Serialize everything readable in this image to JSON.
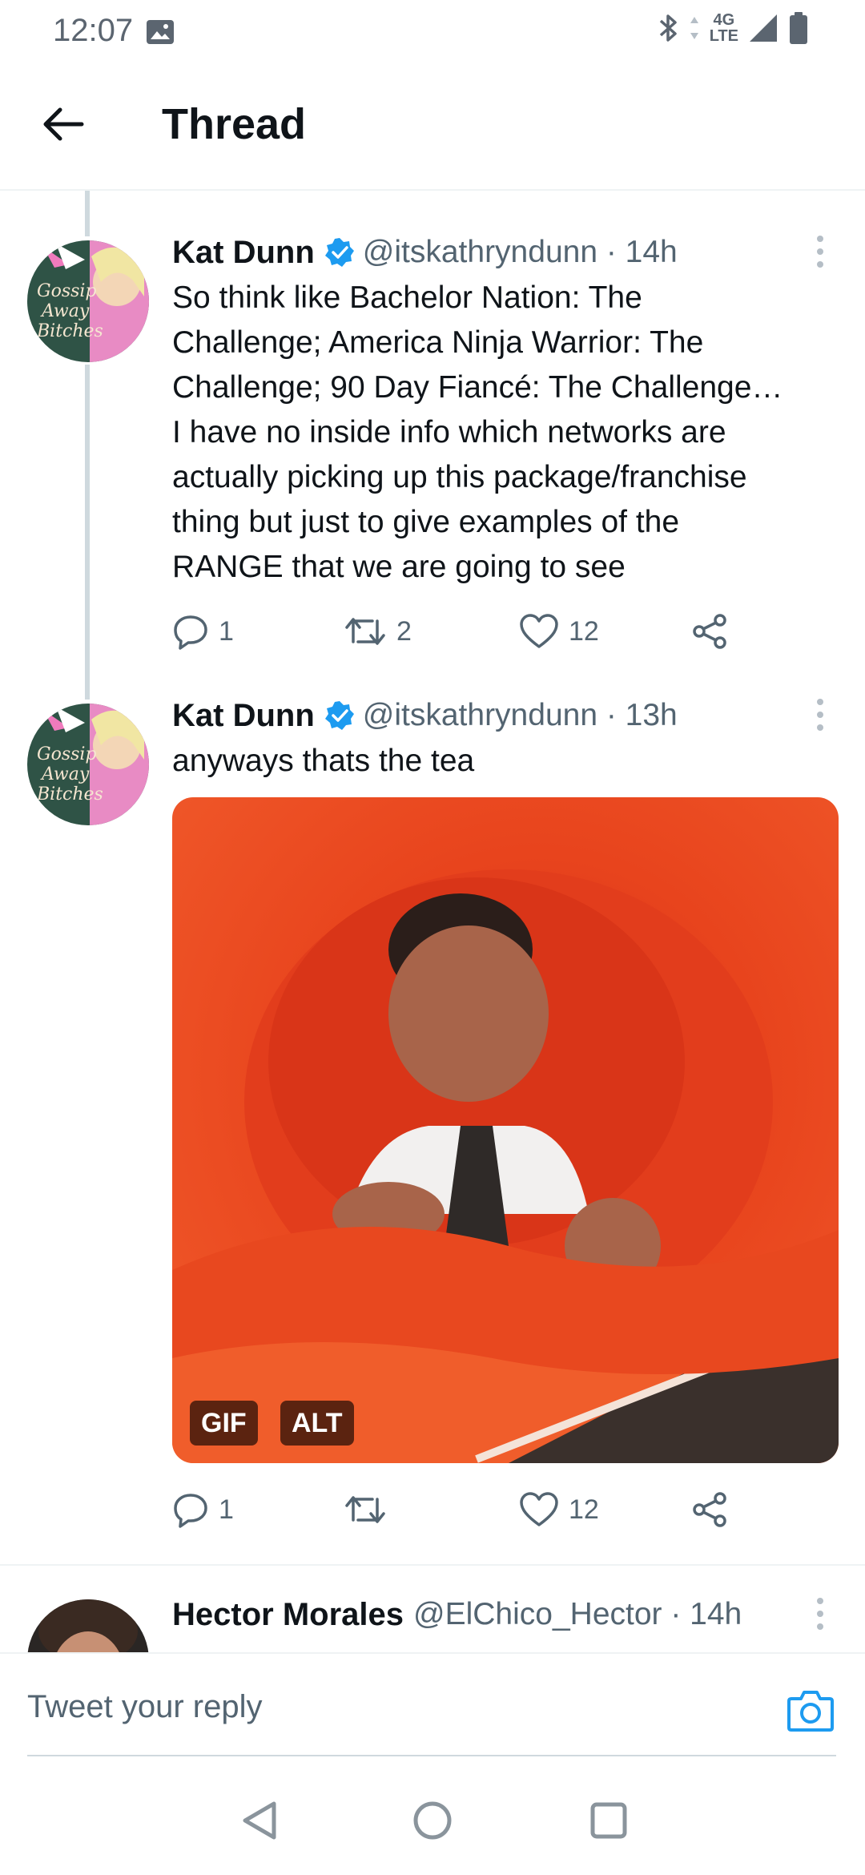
{
  "status_bar": {
    "time": "12:07",
    "network_label_top": "4G",
    "network_label_bottom": "LTE",
    "icons": [
      "photo-icon",
      "bluetooth-icon",
      "signal-icon",
      "battery-icon"
    ],
    "icon_color": "#5b6570"
  },
  "header": {
    "title": "Thread",
    "back_icon": "back-arrow-icon"
  },
  "colors": {
    "accent": "#1d9bf0",
    "text_primary": "#0f1419",
    "text_secondary": "#536471",
    "thread_line": "#cfd9de",
    "media_background": "#e8441d"
  },
  "tweets": [
    {
      "author": "Kat Dunn",
      "verified": true,
      "handle": "@itskathryndunn · 14h",
      "text": "So think like Bachelor Nation: The\nChallenge; America Ninja Warrior: The\nChallenge; 90 Day Fiancé: The Challenge…\nI have no inside info which networks are\nactually picking up this package/franchise\nthing but just to give examples of the\nRANGE that we are going to see",
      "replies": "1",
      "retweets": "2",
      "likes": "12"
    },
    {
      "author": "Kat Dunn",
      "verified": true,
      "handle": "@itskathryndunn · 13h",
      "text": "anyways thats the tea",
      "media_badges": [
        "GIF",
        "ALT"
      ],
      "replies": "1",
      "retweets": "",
      "likes": "12"
    },
    {
      "author": "Hector Morales",
      "verified": false,
      "handle": "@ElChico_Hector · 14h"
    }
  ],
  "reply": {
    "placeholder": "Tweet your reply",
    "camera_icon": "camera-icon"
  },
  "nav": {
    "icons": [
      "nav-back-icon",
      "nav-home-icon",
      "nav-recents-icon"
    ]
  }
}
